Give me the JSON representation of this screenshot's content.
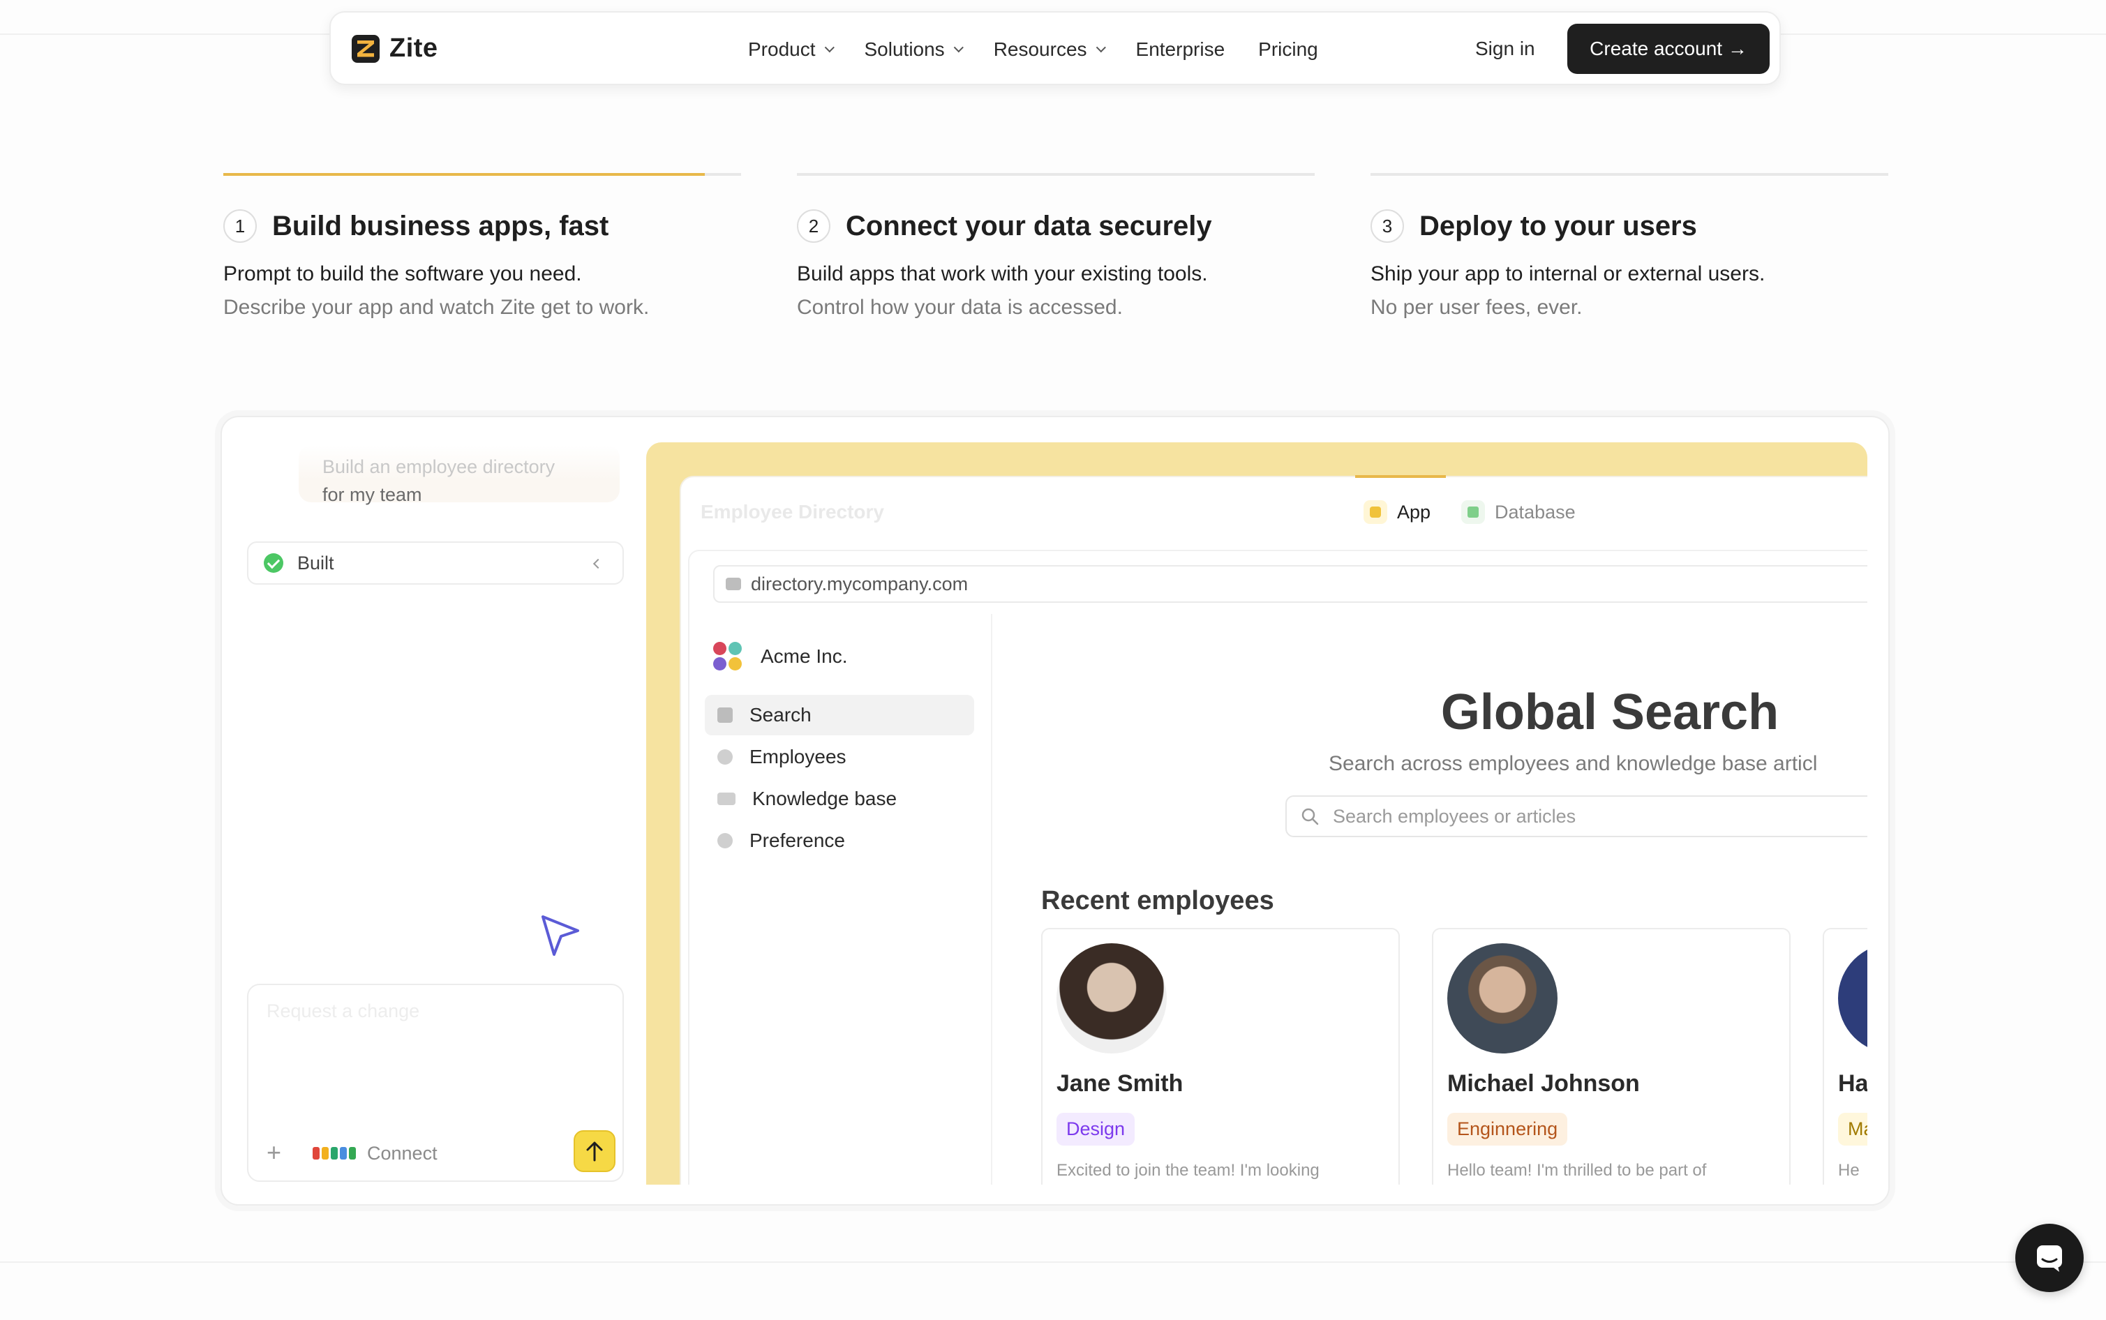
{
  "nav": {
    "brand": "Zite",
    "links": [
      {
        "label": "Product",
        "has_menu": true
      },
      {
        "label": "Solutions",
        "has_menu": true
      },
      {
        "label": "Resources",
        "has_menu": true
      },
      {
        "label": "Enterprise",
        "has_menu": false
      },
      {
        "label": "Pricing",
        "has_menu": false
      }
    ],
    "sign_in": "Sign in",
    "create_account": "Create account →"
  },
  "steps": [
    {
      "num": "1",
      "title": "Build business apps, fast",
      "line1": "Prompt to build the software you need.",
      "line2": "Describe your app and watch Zite get to work.",
      "progress": 0.93
    },
    {
      "num": "2",
      "title": "Connect your data securely",
      "line1": "Build apps that work with your existing tools.",
      "line2": "Control how your data is accessed.",
      "progress": 0
    },
    {
      "num": "3",
      "title": "Deploy to your users",
      "line1": "Ship your app to internal or external users.",
      "line2": "No per user fees, ever.",
      "progress": 0
    }
  ],
  "builder": {
    "prompt_line1": "Build an employee directory",
    "prompt_line2": "for my team",
    "status": "Built",
    "composer_placeholder": "Request a change",
    "connect_label": "Connect"
  },
  "preview": {
    "window_title": "Employee Directory",
    "tabs": [
      {
        "label": "App",
        "active": true
      },
      {
        "label": "Database",
        "active": false
      }
    ],
    "url": "directory.mycompany.com",
    "org_name": "Acme Inc.",
    "sidebar": [
      "Search",
      "Employees",
      "Knowledge base",
      "Preference"
    ],
    "heading": "Global Search",
    "subheading": "Search across employees and knowledge base articl",
    "search_placeholder": "Search employees or articles",
    "recent_title": "Recent employees",
    "employees": [
      {
        "name": "Jane Smith",
        "badge": "Design",
        "badge_color": "#7c3aed",
        "badge_bg": "#f3ebff",
        "bio": "Excited to join the team! I'm looking"
      },
      {
        "name": "Michael Johnson",
        "badge": "Enginnering",
        "badge_color": "#b4551b",
        "badge_bg": "#fdf0e0",
        "bio": "Hello team! I'm thrilled to be part of"
      },
      {
        "name": "Ha",
        "badge": "Ma",
        "badge_color": "#a07a00",
        "badge_bg": "#fff7dc",
        "bio": "He"
      }
    ]
  },
  "colors": {
    "accent": "#e8b84a",
    "dark": "#1f1f1f",
    "preview_bg": "#f6e3a0"
  }
}
